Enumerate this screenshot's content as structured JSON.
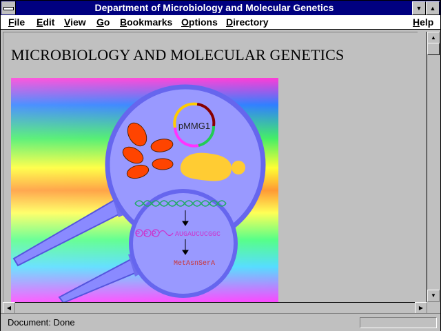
{
  "window": {
    "title": "Department of Microbiology and Molecular Genetics"
  },
  "menubar": {
    "file": "File",
    "edit": "Edit",
    "view": "View",
    "go": "Go",
    "bookmarks": "Bookmarks",
    "options": "Options",
    "directory": "Directory",
    "help": "Help"
  },
  "page": {
    "heading": "MICROBIOLOGY AND MOLECULAR GENETICS",
    "image": {
      "plasmid_label": "pMMG1",
      "ppp_label": "PPP",
      "rna_sequence": "AUGAUCUCGGC",
      "peptide_sequence": "MetAsnSerA"
    }
  },
  "status": {
    "text": "Document: Done"
  },
  "icons": {
    "system_menu": "system-menu-icon",
    "minimize": "minimize-icon",
    "maximize": "maximize-icon",
    "scroll_up": "scroll-up-arrow-icon",
    "scroll_down": "scroll-down-arrow-icon",
    "scroll_left": "scroll-left-arrow-icon",
    "scroll_right": "scroll-right-arrow-icon"
  },
  "colors": {
    "titlebar": "#000080",
    "cell_fill": "#9999ff",
    "cell_border": "#6666ee",
    "mitochondria": "#ff4400",
    "nucleus": "#ffcc33",
    "rna_text": "#cc33cc",
    "peptide_text": "#cc3333",
    "dna_helix": "#22aa66"
  }
}
